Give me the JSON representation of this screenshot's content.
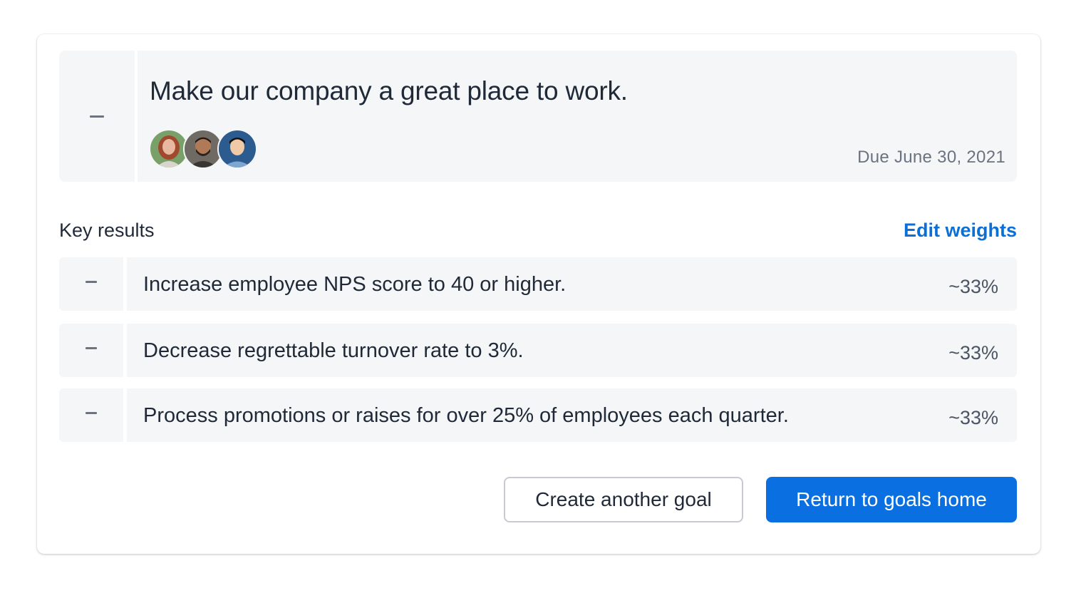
{
  "goal": {
    "collapse_icon": "minus-icon",
    "title": "Make our company a great place to work.",
    "owners": [
      {
        "name": "avatar-woman-red-hair",
        "bg": "#7aa06a",
        "skin": "#e8b9a0",
        "hair": "#a0492e"
      },
      {
        "name": "avatar-man-beard",
        "bg": "#6f6a63",
        "skin": "#b07a58",
        "hair": "#1d1a18"
      },
      {
        "name": "avatar-man-blue-shirt",
        "bg": "#2b5b8f",
        "skin": "#f0c9a6",
        "hair": "#111111"
      }
    ],
    "due": "Due June 30, 2021"
  },
  "key_results": {
    "heading": "Key results",
    "edit_label": "Edit weights",
    "items": [
      {
        "text": "Increase employee NPS score to 40 or higher.",
        "weight": "~33%"
      },
      {
        "text": "Decrease regrettable turnover rate to 3%.",
        "weight": "~33%"
      },
      {
        "text": "Process promotions or raises for over 25% of employees each quarter.",
        "weight": "~33%"
      }
    ]
  },
  "actions": {
    "secondary_label": "Create another goal",
    "primary_label": "Return to goals home"
  },
  "colors": {
    "accent": "#0a6fe0",
    "link": "#0a6fd6",
    "panel": "#f4f6f8"
  }
}
